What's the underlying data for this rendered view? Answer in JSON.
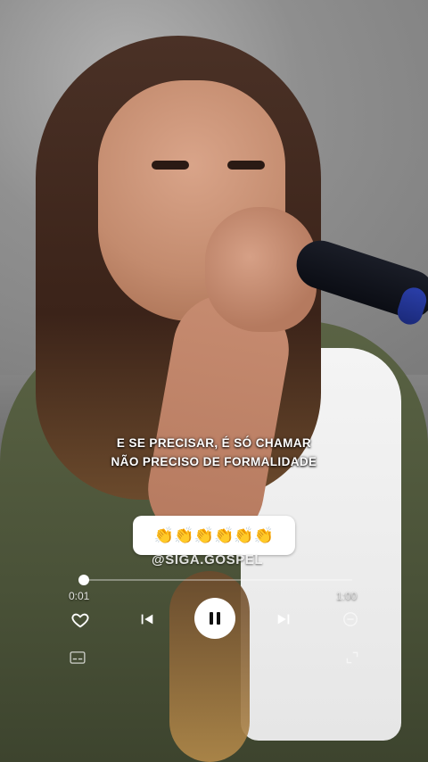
{
  "captions": {
    "line1": "E SE PRECISAR, É SÓ CHAMAR",
    "line2": "NÃO PRECISO DE FORMALIDADE"
  },
  "emoji_row": "👏👏👏👏👏👏",
  "watermark": "@SIGA.GOSPEL",
  "player": {
    "current_time": "0:01",
    "duration": "1:00",
    "progress": 0.017,
    "icons": {
      "like": "heart-icon",
      "previous": "previous-icon",
      "play_pause": "pause-icon",
      "next": "next-icon",
      "volume": "minus-icon",
      "captions": "captions-icon",
      "expand": "expand-icon"
    }
  }
}
